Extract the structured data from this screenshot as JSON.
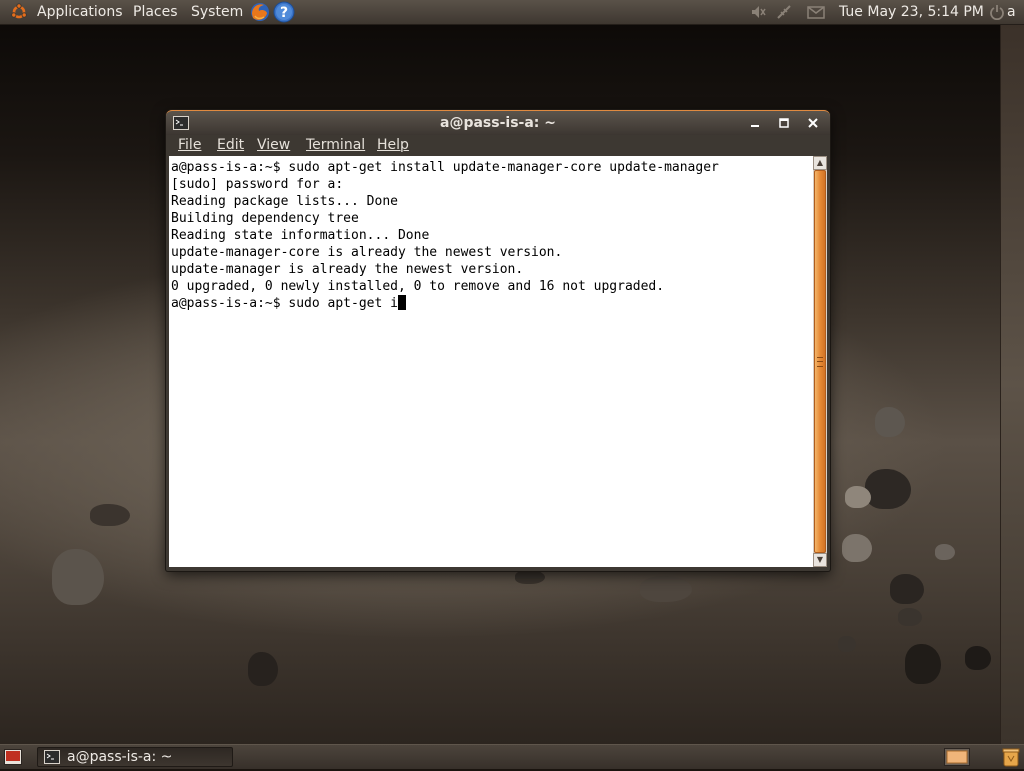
{
  "top_panel": {
    "menus": [
      "Applications",
      "Places",
      "System"
    ],
    "clock": "Tue May 23,  5:14 PM",
    "user": "a"
  },
  "terminal": {
    "title": "a@pass-is-a: ~",
    "menu": [
      "File",
      "Edit",
      "View",
      "Terminal",
      "Help"
    ],
    "lines": [
      "a@pass-is-a:~$ sudo apt-get install update-manager-core update-manager",
      "[sudo] password for a:",
      "Reading package lists... Done",
      "Building dependency tree",
      "Reading state information... Done",
      "update-manager-core is already the newest version.",
      "update-manager is already the newest version.",
      "0 upgraded, 0 newly installed, 0 to remove and 16 not upgraded."
    ],
    "prompt_line": "a@pass-is-a:~$ sudo apt-get i"
  },
  "taskbar": {
    "items": [
      {
        "label": "a@pass-is-a: ~"
      }
    ]
  },
  "colors": {
    "accent": "#e68a36",
    "panel": "#3e3730",
    "terminal_bg": "#ffffff",
    "terminal_fg": "#000000"
  },
  "icons": {
    "top_panel": [
      "ubuntu-logo-icon",
      "firefox-icon",
      "help-icon",
      "volume-icon",
      "network-icon",
      "mail-icon",
      "power-icon"
    ],
    "bottom_panel": [
      "show-desktop-icon",
      "terminal-icon",
      "workspace-switcher-icon",
      "trash-icon"
    ]
  }
}
